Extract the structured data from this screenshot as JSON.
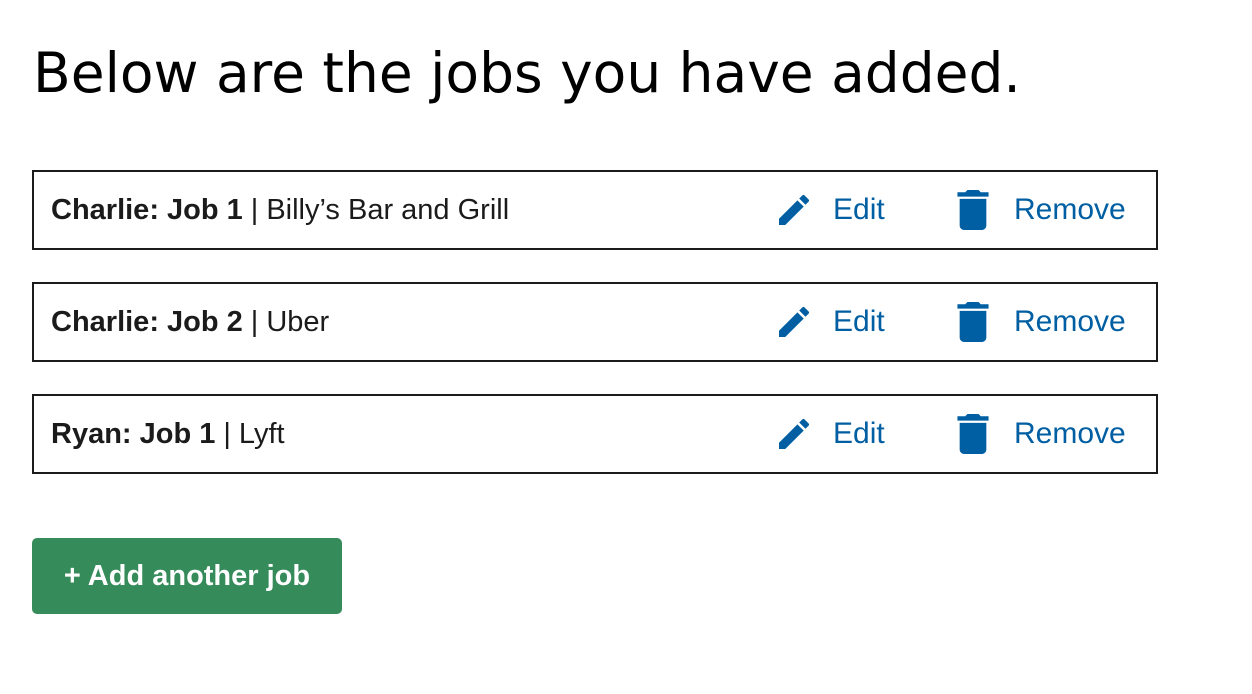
{
  "page": {
    "title": "Below are the jobs you have added."
  },
  "jobs": [
    {
      "name": "Charlie: Job 1",
      "separator": "|",
      "employer": "Billy’s Bar and Grill",
      "edit_label": "Edit",
      "remove_label": "Remove"
    },
    {
      "name": "Charlie: Job 2",
      "separator": "|",
      "employer": "Uber",
      "edit_label": "Edit",
      "remove_label": "Remove"
    },
    {
      "name": "Ryan: Job 1",
      "separator": "|",
      "employer": "Lyft",
      "edit_label": "Edit",
      "remove_label": "Remove"
    }
  ],
  "icons": {
    "edit": "pencil-icon",
    "remove": "trash-icon"
  },
  "add_button": {
    "label": "+ Add another job"
  },
  "colors": {
    "link": "#005ea2",
    "button": "#368b5a",
    "border": "#1b1b1b",
    "text": "#1b1b1b"
  }
}
